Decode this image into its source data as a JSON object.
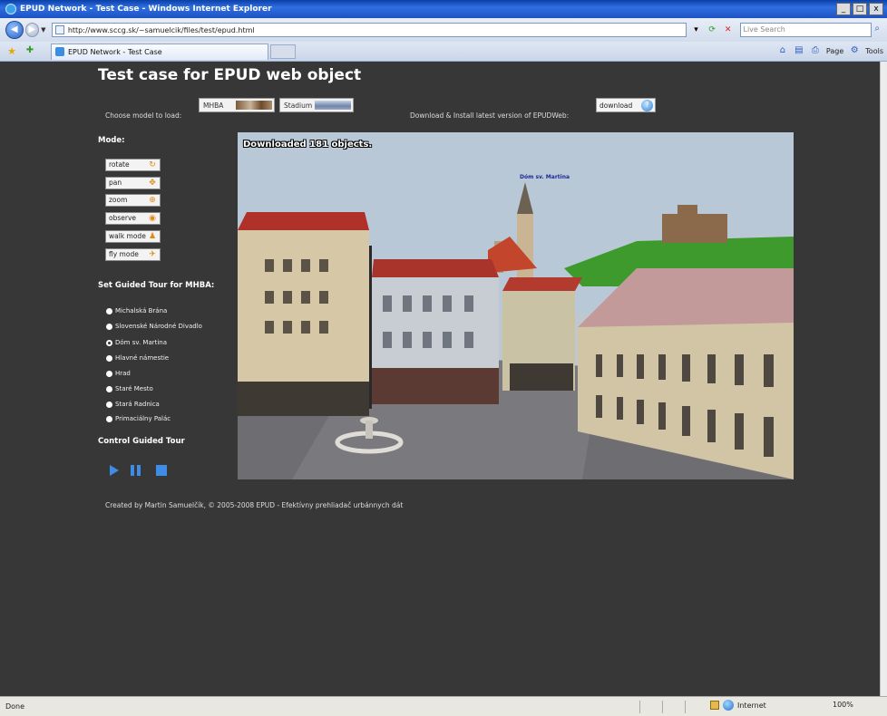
{
  "window": {
    "title": "EPUD Network - Test Case - Windows Internet Explorer",
    "min": "_",
    "max": "□",
    "close": "x"
  },
  "browser": {
    "address": "http://www.sccg.sk/~samuelcik/files/test/epud.html",
    "search_placeholder": "Live Search",
    "tab_label": "EPUD Network - Test Case",
    "page_menu": "Page",
    "tools_menu": "Tools"
  },
  "page": {
    "title": "Test case for EPUD web object",
    "choose_model_label": "Choose model to load:",
    "model_buttons": [
      "MHBA",
      "Stadium"
    ],
    "download_label": "Download & Install latest version of EPUDWeb:",
    "download_button": "download",
    "mode_heading": "Mode:",
    "modes": [
      "rotate",
      "pan",
      "zoom",
      "observe",
      "walk mode",
      "fly mode"
    ],
    "tour_heading": "Set Guided Tour for MHBA:",
    "tour_items": [
      "Michalská Brána",
      "Slovenské Národné Divadlo",
      "Dóm sv. Martina",
      "Hlavné námestie",
      "Hrad",
      "Staré Mesto",
      "Stará Radnica",
      "Primaciálny Palác"
    ],
    "tour_selected": 2,
    "control_heading": "Control Guided Tour",
    "viewport_status": "Downloaded 181 objects.",
    "viewport_poi": "Dóm sv. Martina",
    "footer": "Created by Martin Samuelčík, © 2005-2008 EPUD - Efektívny prehliadač urbánnych dát"
  },
  "status": {
    "left": "Done",
    "zone": "Internet",
    "zoom": "100%"
  },
  "colors": {
    "page_background": "#373737",
    "accent_blue": "#3d8de8",
    "roof_red": "#b0302a"
  }
}
